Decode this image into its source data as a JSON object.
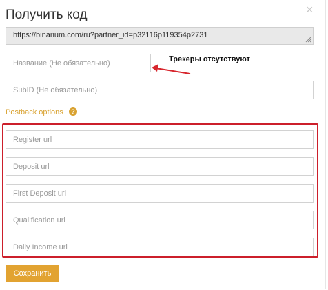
{
  "modal": {
    "title": "Получить код",
    "close_symbol": "×"
  },
  "link": {
    "url": "https://binarium.com/ru?partner_id=p32116p119354p2731"
  },
  "name_field": {
    "placeholder": "Название (Не обязательно)",
    "value": ""
  },
  "trackers_notice": "Трекеры отсутствуют",
  "subid_field": {
    "placeholder": "SubID (Не обязательно)",
    "value": ""
  },
  "postback": {
    "label": "Postback options",
    "help_symbol": "?",
    "fields": [
      {
        "placeholder": "Register url"
      },
      {
        "placeholder": "Deposit url"
      },
      {
        "placeholder": "First Deposit url"
      },
      {
        "placeholder": "Qualification url"
      },
      {
        "placeholder": "Daily Income url"
      }
    ]
  },
  "save_label": "Сохранить",
  "colors": {
    "accent": "#e2a331",
    "postback_label": "#d9a230",
    "highlight_frame": "#cc1f2b"
  },
  "icons": [
    "close-icon",
    "help-icon",
    "resize-grip-icon",
    "annotation-arrow"
  ]
}
